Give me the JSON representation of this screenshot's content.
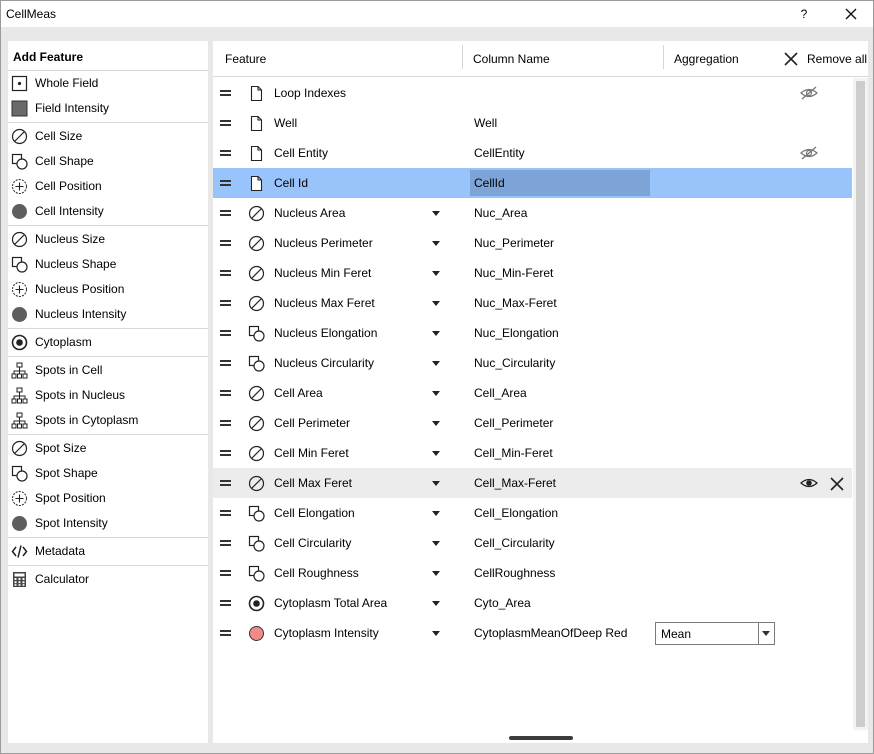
{
  "window": {
    "title": "CellMeas",
    "help_label": "?"
  },
  "add_feature": {
    "title": "Add Feature",
    "groups": [
      [
        {
          "label": "Whole Field",
          "icon": "field-dot-icon"
        },
        {
          "label": "Field Intensity",
          "icon": "intensity-square-icon"
        }
      ],
      [
        {
          "label": "Cell Size",
          "icon": "diameter-icon"
        },
        {
          "label": "Cell Shape",
          "icon": "shape-icon"
        },
        {
          "label": "Cell Position",
          "icon": "position-icon"
        },
        {
          "label": "Cell Intensity",
          "icon": "intensity-circle-icon"
        }
      ],
      [
        {
          "label": "Nucleus Size",
          "icon": "diameter-icon"
        },
        {
          "label": "Nucleus Shape",
          "icon": "shape-icon"
        },
        {
          "label": "Nucleus Position",
          "icon": "position-icon"
        },
        {
          "label": "Nucleus Intensity",
          "icon": "intensity-circle-icon"
        }
      ],
      [
        {
          "label": "Cytoplasm",
          "icon": "cytoplasm-icon"
        }
      ],
      [
        {
          "label": "Spots in Cell",
          "icon": "hierarchy-icon"
        },
        {
          "label": "Spots in Nucleus",
          "icon": "hierarchy-icon"
        },
        {
          "label": "Spots in Cytoplasm",
          "icon": "hierarchy-icon"
        }
      ],
      [
        {
          "label": "Spot Size",
          "icon": "diameter-icon"
        },
        {
          "label": "Spot Shape",
          "icon": "shape-icon"
        },
        {
          "label": "Spot Position",
          "icon": "position-icon"
        },
        {
          "label": "Spot Intensity",
          "icon": "intensity-circle-icon"
        }
      ],
      [
        {
          "label": "Metadata",
          "icon": "code-icon"
        }
      ],
      [
        {
          "label": "Calculator",
          "icon": "calculator-icon"
        }
      ]
    ]
  },
  "table": {
    "headers": {
      "feature": "Feature",
      "column_name": "Column Name",
      "aggregation": "Aggregation"
    },
    "remove_all_label": "Remove all",
    "rows": [
      {
        "feature": "Loop Indexes",
        "icon": "page-icon",
        "column": "",
        "dropdown": false,
        "vis": "hidden-eye-icon"
      },
      {
        "feature": "Well",
        "icon": "page-icon",
        "column": "Well",
        "dropdown": false
      },
      {
        "feature": "Cell Entity",
        "icon": "page-icon",
        "column": "CellEntity",
        "dropdown": false,
        "vis": "hidden-eye-icon"
      },
      {
        "feature": "Cell Id",
        "icon": "page-icon",
        "column": "CellId",
        "dropdown": false,
        "state": "selected"
      },
      {
        "feature": "Nucleus Area",
        "icon": "diameter-icon",
        "column": "Nuc_Area",
        "dropdown": true
      },
      {
        "feature": "Nucleus Perimeter",
        "icon": "diameter-icon",
        "column": "Nuc_Perimeter",
        "dropdown": true
      },
      {
        "feature": "Nucleus Min Feret",
        "icon": "diameter-icon",
        "column": "Nuc_Min-Feret",
        "dropdown": true
      },
      {
        "feature": "Nucleus Max Feret",
        "icon": "diameter-icon",
        "column": "Nuc_Max-Feret",
        "dropdown": true
      },
      {
        "feature": "Nucleus Elongation",
        "icon": "shape-icon",
        "column": "Nuc_Elongation",
        "dropdown": true
      },
      {
        "feature": "Nucleus Circularity",
        "icon": "shape-icon",
        "column": "Nuc_Circularity",
        "dropdown": true
      },
      {
        "feature": "Cell Area",
        "icon": "diameter-icon",
        "column": "Cell_Area",
        "dropdown": true
      },
      {
        "feature": "Cell Perimeter",
        "icon": "diameter-icon",
        "column": "Cell_Perimeter",
        "dropdown": true
      },
      {
        "feature": "Cell Min Feret",
        "icon": "diameter-icon",
        "column": "Cell_Min-Feret",
        "dropdown": true
      },
      {
        "feature": "Cell Max Feret",
        "icon": "diameter-icon",
        "column": "Cell_Max-Feret",
        "dropdown": true,
        "state": "hover",
        "vis": "eye-icon",
        "delete": true
      },
      {
        "feature": "Cell Elongation",
        "icon": "shape-icon",
        "column": "Cell_Elongation",
        "dropdown": true
      },
      {
        "feature": "Cell Circularity",
        "icon": "shape-icon",
        "column": "Cell_Circularity",
        "dropdown": true
      },
      {
        "feature": "Cell Roughness",
        "icon": "shape-icon",
        "column": "CellRoughness",
        "dropdown": true
      },
      {
        "feature": "Cytoplasm Total Area",
        "icon": "cytoplasm-icon",
        "column": "Cyto_Area",
        "dropdown": true
      },
      {
        "feature": "Cytoplasm Intensity",
        "icon": "red-intensity-icon",
        "column": "CytoplasmMeanOfDeep Red",
        "dropdown": true,
        "aggregation": "Mean"
      }
    ]
  },
  "colors": {
    "selected_row": "#99c4fb",
    "editing_cell": "#7ea4d7",
    "hover_row": "#ececec",
    "intensity_red": "#f08b87"
  }
}
